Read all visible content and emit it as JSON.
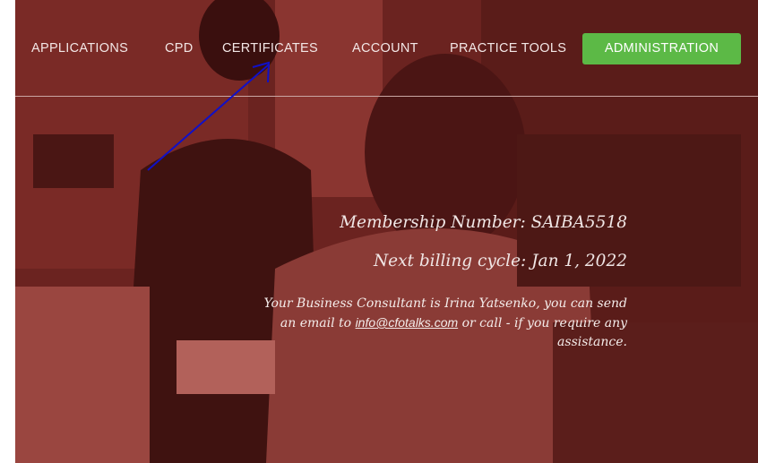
{
  "nav": {
    "items": [
      {
        "label": "APPLICATIONS"
      },
      {
        "label": "CPD"
      },
      {
        "label": "CERTIFICATES"
      },
      {
        "label": "ACCOUNT"
      },
      {
        "label": "PRACTICE TOOLS"
      }
    ],
    "admin_label": "ADMINISTRATION"
  },
  "info": {
    "membership": "Membership Number: SAIBA5518",
    "billing": "Next billing cycle: Jan 1, 2022",
    "consultant_prefix": "Your Business Consultant is Irina Yatsenko, you can send an email to ",
    "email": "info@cfotalks.com",
    "consultant_suffix": " or call - if you require any assistance."
  },
  "colors": {
    "overlay": "#6e2420",
    "admin_button": "#5cb946",
    "annotation_arrow": "#1010c8"
  }
}
